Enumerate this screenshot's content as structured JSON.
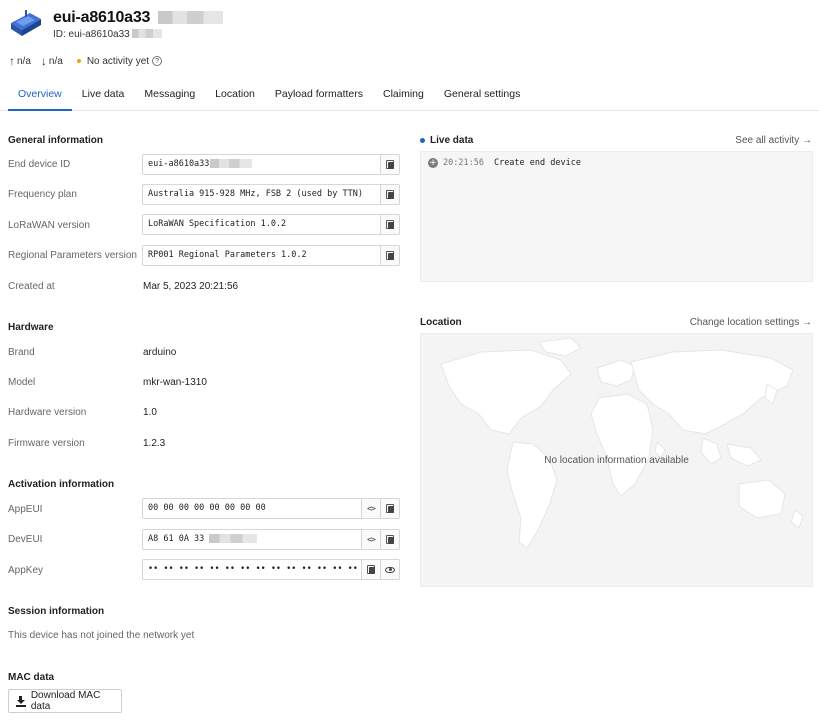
{
  "device": {
    "title": "eui-a8610a33",
    "id_label": "ID: eui-a8610a33"
  },
  "stats": {
    "uplink": "n/a",
    "downlink": "n/a",
    "activity": "No activity yet"
  },
  "tabs": [
    {
      "label": "Overview",
      "active": true
    },
    {
      "label": "Live data"
    },
    {
      "label": "Messaging"
    },
    {
      "label": "Location"
    },
    {
      "label": "Payload formatters"
    },
    {
      "label": "Claiming"
    },
    {
      "label": "General settings"
    }
  ],
  "general": {
    "title": "General information",
    "end_device_id_label": "End device ID",
    "end_device_id": "eui-a8610a33",
    "frequency_plan_label": "Frequency plan",
    "frequency_plan": "Australia 915-928 MHz, FSB 2 (used by TTN)",
    "lorawan_version_label": "LoRaWAN version",
    "lorawan_version": "LoRaWAN Specification 1.0.2",
    "regional_params_label": "Regional Parameters version",
    "regional_params": "RP001 Regional Parameters 1.0.2",
    "created_at_label": "Created at",
    "created_at": "Mar 5, 2023 20:21:56"
  },
  "hardware": {
    "title": "Hardware",
    "brand_label": "Brand",
    "brand": "arduino",
    "model_label": "Model",
    "model": "mkr-wan-1310",
    "hw_version_label": "Hardware version",
    "hw_version": "1.0",
    "fw_version_label": "Firmware version",
    "fw_version": "1.2.3"
  },
  "activation": {
    "title": "Activation information",
    "appeui_label": "AppEUI",
    "appeui": "00 00 00 00 00 00 00 00",
    "deveui_label": "DevEUI",
    "deveui": "A8 61 0A 33",
    "appkey_label": "AppKey",
    "appkey": "•• •• •• •• •• •• •• •• •• •• •• •• •• •• •• ••"
  },
  "session": {
    "title": "Session information",
    "text": "This device has not joined the network yet"
  },
  "mac": {
    "title": "MAC data",
    "download_label": "Download MAC data"
  },
  "live_data": {
    "title": "Live data",
    "link": "See all activity →",
    "event_time": "20:21:56",
    "event_text": "Create end device"
  },
  "location": {
    "title": "Location",
    "link": "Change location settings →",
    "empty": "No location information available"
  },
  "colors": {
    "accent": "#1f62c8",
    "activity_dot": "#f0a020"
  }
}
